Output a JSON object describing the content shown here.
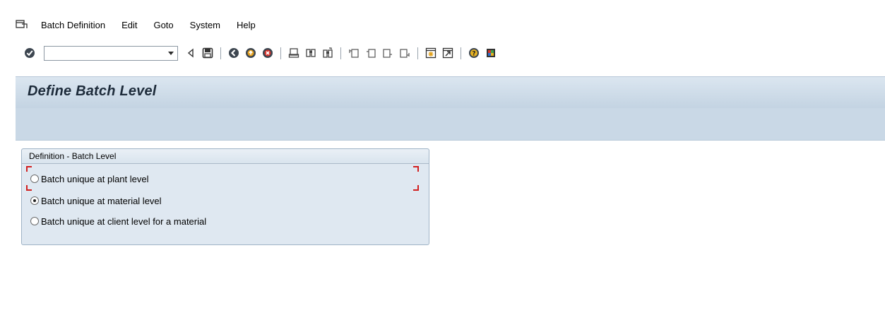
{
  "menu": {
    "items": [
      {
        "label": "Batch Definition"
      },
      {
        "label": "Edit"
      },
      {
        "label": "Goto"
      },
      {
        "label": "System"
      },
      {
        "label": "Help"
      }
    ]
  },
  "toolbar": {
    "command_field_value": "",
    "icons": [
      "enter-icon",
      "back-arrow-icon",
      "save-icon",
      "back-icon",
      "exit-icon",
      "cancel-icon",
      "print-icon",
      "find-icon",
      "find-next-icon",
      "first-page-icon",
      "previous-page-icon",
      "next-page-icon",
      "last-page-icon",
      "create-session-icon",
      "shortcut-icon",
      "help-icon",
      "customize-layout-icon"
    ]
  },
  "screen": {
    "title": "Define Batch Level"
  },
  "groupbox": {
    "title": "Definition - Batch Level",
    "options": [
      {
        "label": "Batch unique at plant level",
        "selected": false
      },
      {
        "label": "Batch unique at material level",
        "selected": true
      },
      {
        "label": "Batch unique at client level for a material",
        "selected": false
      }
    ]
  }
}
